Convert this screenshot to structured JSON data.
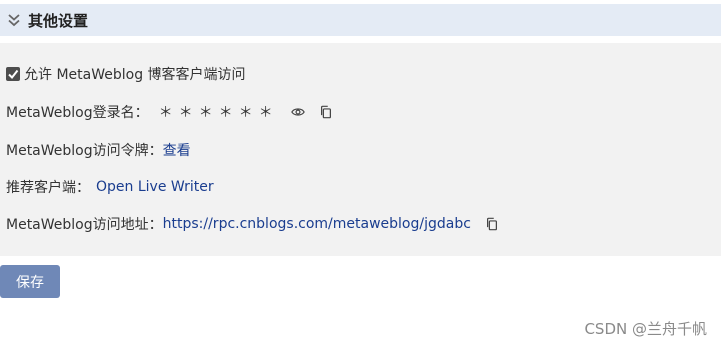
{
  "section": {
    "title": "其他设置",
    "icon": "double-chevron-down-icon"
  },
  "settings": {
    "allow_metaweblog": {
      "checked": true,
      "label": "允许 MetaWeblog 博客客户端访问"
    },
    "login_name": {
      "label": "MetaWeblog登录名：",
      "value": "＊＊＊＊＊＊",
      "icons": [
        "eye-icon",
        "copy-icon"
      ]
    },
    "token": {
      "label": "MetaWeblog访问令牌：",
      "link": "查看"
    },
    "client": {
      "label": "推荐客户端：",
      "link": "Open Live Writer"
    },
    "url": {
      "label": "MetaWeblog访问地址：",
      "link": "https://rpc.cnblogs.com/metaweblog/jgdabc",
      "icon": "copy-icon"
    }
  },
  "actions": {
    "save_label": "保存"
  },
  "watermark": "CSDN @兰舟千帆",
  "colors": {
    "header_bg": "#e4ebf5",
    "body_bg": "#f2f2f2",
    "button_bg": "#6f88b7",
    "link": "#1a3d8f"
  }
}
